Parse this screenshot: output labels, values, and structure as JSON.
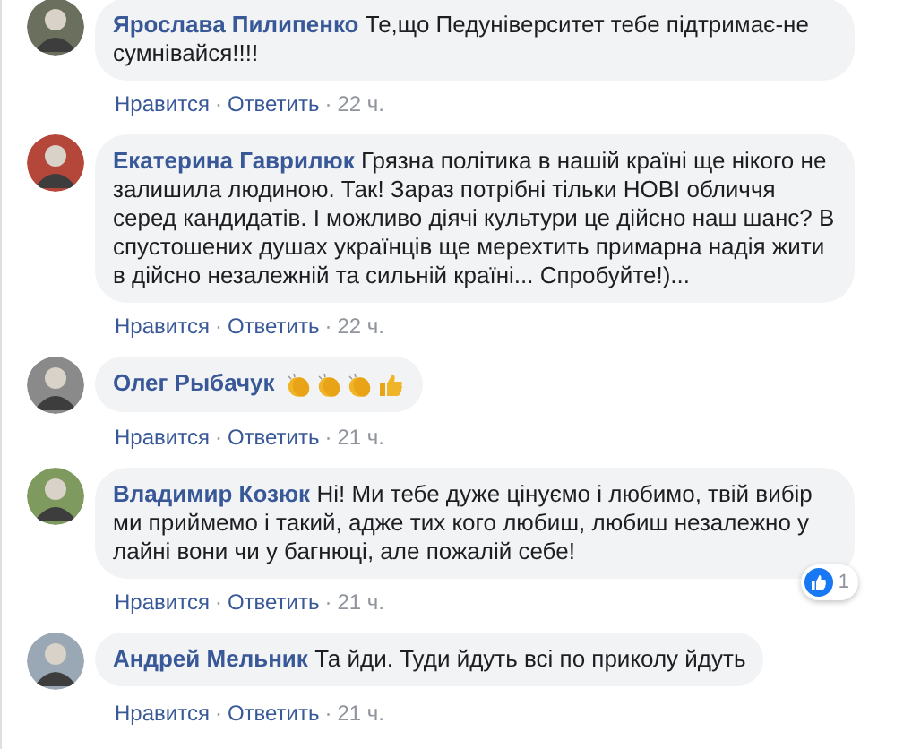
{
  "comments": [
    {
      "author": "Ярослава Пилипенко",
      "text": "Те,що Педуніверситет тебе підтримає-не сумнівайся!!!!",
      "like": "Нравится",
      "separator": "·",
      "reply": "Ответить",
      "time": "22 ч."
    },
    {
      "author": "Екатерина Гаврилюк",
      "text": "Грязна політика в нашій країні ще нікого не залишила людиною. Так! Зараз потрібні тільки НОВІ обличчя серед кандидатів. І можливо діячі культури це дійсно наш шанс? В спустошених душах українців ще мерехтить примарна надія жити в дійсно незалежній та сильній країні... Спробуйте!)...",
      "like": "Нравится",
      "separator": "·",
      "reply": "Ответить",
      "time": "22 ч."
    },
    {
      "author": "Олег Рыбачук",
      "emoji": [
        {
          "kind": "clap"
        },
        {
          "kind": "clap"
        },
        {
          "kind": "clap"
        },
        {
          "kind": "thumbs_up"
        }
      ],
      "like": "Нравится",
      "separator": "·",
      "reply": "Ответить",
      "time": "21 ч."
    },
    {
      "author": "Владимир Козюк",
      "text": "Ні! Ми тебе дуже цінуємо і любимо, твій вибір ми приймемо і такий, адже тих кого любиш, любиш незалежно у лайні вони чи у багнюці, але пожалій себе!",
      "like": "Нравится",
      "separator": "·",
      "reply": "Ответить",
      "time": "21 ч.",
      "reaction_count": "1"
    },
    {
      "author": "Андрей Мельник",
      "text": "Та йди. Туди йдуть всі по приколу йдуть",
      "like": "Нравится",
      "separator": "·",
      "reply": "Ответить",
      "time": "21 ч."
    }
  ]
}
